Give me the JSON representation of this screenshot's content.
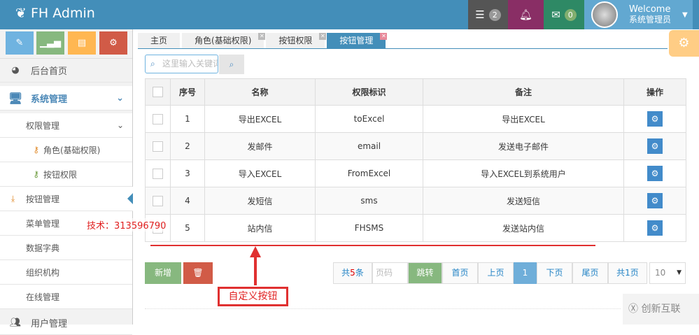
{
  "header": {
    "brand": "FH Admin",
    "tasks_count": "2",
    "messages_count": "0",
    "welcome": "Welcome",
    "username": "系统管理员"
  },
  "sidebar": {
    "items": [
      {
        "label": "后台首页"
      },
      {
        "label": "系统管理"
      },
      {
        "label": "权限管理"
      },
      {
        "label": "角色(基础权限)"
      },
      {
        "label": "按钮权限"
      },
      {
        "label": "按钮管理"
      },
      {
        "label": "菜单管理"
      },
      {
        "label": "数据字典"
      },
      {
        "label": "组织机构"
      },
      {
        "label": "在线管理"
      },
      {
        "label": "用户管理"
      }
    ]
  },
  "tabs": [
    {
      "label": "主页"
    },
    {
      "label": "角色(基础权限)"
    },
    {
      "label": "按钮权限"
    },
    {
      "label": "按钮管理"
    }
  ],
  "search": {
    "placeholder": "这里输入关键词"
  },
  "table": {
    "headers": [
      "序号",
      "名称",
      "权限标识",
      "备注",
      "操作"
    ],
    "rows": [
      {
        "no": "1",
        "name": "导出EXCEL",
        "code": "toExcel",
        "note": "导出EXCEL"
      },
      {
        "no": "2",
        "name": "发邮件",
        "code": "email",
        "note": "发送电子邮件"
      },
      {
        "no": "3",
        "name": "导入EXCEL",
        "code": "FromExcel",
        "note": "导入EXCEL到系统用户"
      },
      {
        "no": "4",
        "name": "发短信",
        "code": "sms",
        "note": "发送短信"
      },
      {
        "no": "5",
        "name": "站内信",
        "code": "FHSMS",
        "note": "发送站内信"
      }
    ]
  },
  "actions": {
    "add": "新增"
  },
  "pagination": {
    "total_prefix": "共",
    "total": "5",
    "total_suffix": "条",
    "page_placeholder": "页码",
    "jump": "跳转",
    "first": "首页",
    "prev": "上页",
    "current": "1",
    "next": "下页",
    "last": "尾页",
    "pages": "共1页",
    "page_size": "10"
  },
  "annotations": {
    "tech": "技术：313596790",
    "custom_button": "自定义按钮"
  },
  "watermark": "创新互联"
}
